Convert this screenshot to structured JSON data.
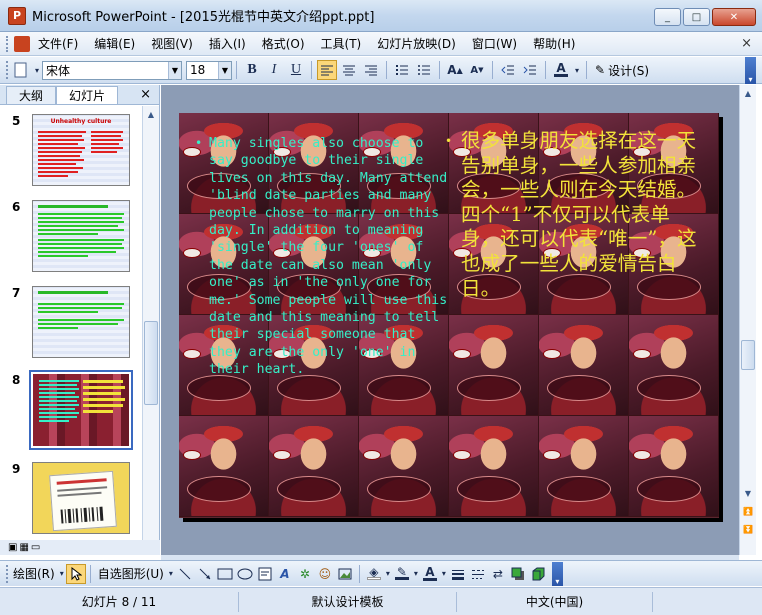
{
  "window": {
    "app_icon_letter": "P",
    "title": "Microsoft PowerPoint - [2015光棍节中英文介绍ppt.ppt]",
    "btn_min": "_",
    "btn_max": "□",
    "btn_close": "✕"
  },
  "menu": {
    "items": [
      "文件(F)",
      "编辑(E)",
      "视图(V)",
      "插入(I)",
      "格式(O)",
      "工具(T)",
      "幻灯片放映(D)",
      "窗口(W)",
      "帮助(H)"
    ],
    "close": "×"
  },
  "toolbar": {
    "font_name": "宋体",
    "font_size": "18",
    "bold": "B",
    "italic": "I",
    "underline": "U",
    "design_label": "设计(S)"
  },
  "left_pane": {
    "tab_outline": "大纲",
    "tab_slides": "幻灯片",
    "close": "×",
    "slides": [
      {
        "num": "5",
        "title": "Unhealthy culture"
      },
      {
        "num": "6",
        "title": "Loneliness celebration 1"
      },
      {
        "num": "7",
        "title": "Loneliness celebration 2"
      },
      {
        "num": "8",
        "title": ""
      },
      {
        "num": "9",
        "title": ""
      }
    ]
  },
  "slide": {
    "left_text": "Many singles also choose to say goodbye to their single lives on this day. Many attend 'blind date parties and many people chose to marry on this day. In addition to meaning 'single' the four 'ones' of the date can also mean 'only one' as in 'the only one for me.' Some people will use this date and this meaning to tell their special someone that they are the only 'one' in their heart.",
    "right_text": "很多单身朋友选择在这一天告别单身，一些人参加相亲会，一些人则在今天结婚。四个“1”不仅可以代表单身，还可以代表“唯一”，这也成了一些人的爱情告白日。",
    "bullet": "•",
    "text_color_left": "#35f0c8",
    "text_color_right": "#f2e33a"
  },
  "drawing_toolbar": {
    "draw_label": "绘图(R)",
    "autoshape_label": "自选图形(U)"
  },
  "status": {
    "slide_info": "幻灯片 8 / 11",
    "template": "默认设计模板",
    "language": "中文(中国)"
  }
}
